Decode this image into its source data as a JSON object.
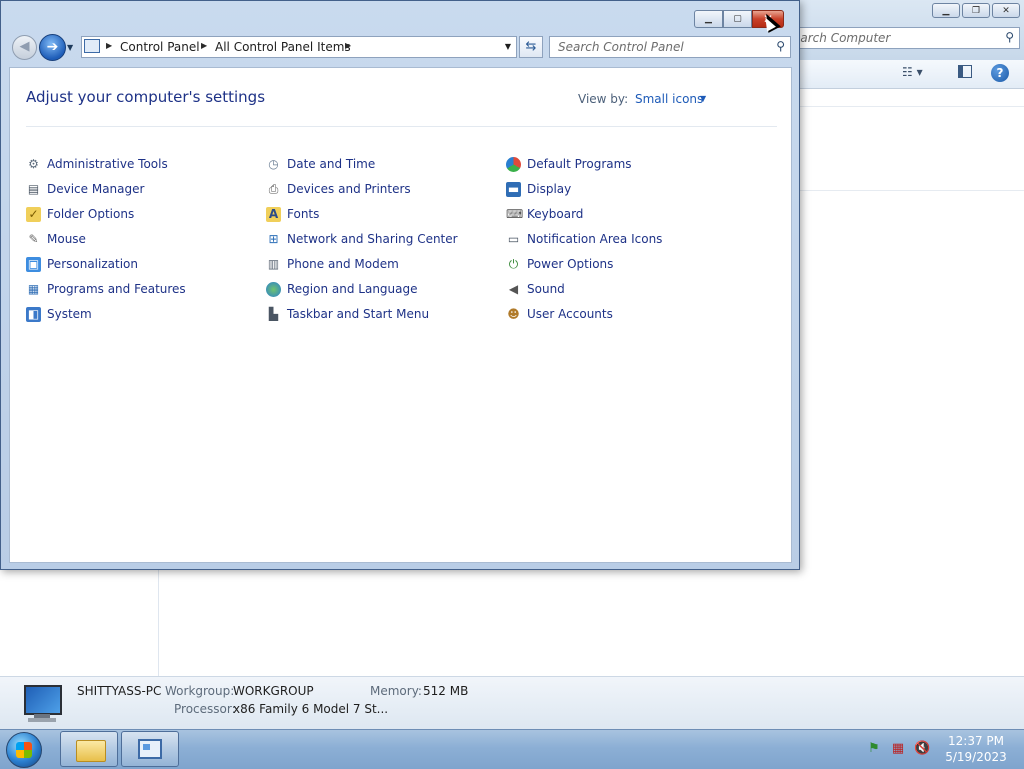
{
  "background_window": {
    "search_placeholder": "earch Computer"
  },
  "control_panel": {
    "breadcrumb": [
      "Control Panel",
      "All Control Panel Items"
    ],
    "search_placeholder": "Search Control Panel",
    "title": "Adjust your computer's settings",
    "view_by_label": "View by:",
    "view_by_value": "Small icons",
    "items": [
      {
        "label": "Administrative Tools",
        "icon": "admin-tools-icon"
      },
      {
        "label": "Device Manager",
        "icon": "device-manager-icon"
      },
      {
        "label": "Folder Options",
        "icon": "folder-options-icon"
      },
      {
        "label": "Mouse",
        "icon": "mouse-icon"
      },
      {
        "label": "Personalization",
        "icon": "personalization-icon"
      },
      {
        "label": "Programs and Features",
        "icon": "programs-icon"
      },
      {
        "label": "System",
        "icon": "system-icon"
      },
      {
        "label": "Date and Time",
        "icon": "clock-icon"
      },
      {
        "label": "Devices and Printers",
        "icon": "printer-icon"
      },
      {
        "label": "Fonts",
        "icon": "fonts-icon"
      },
      {
        "label": "Network and Sharing Center",
        "icon": "network-icon"
      },
      {
        "label": "Phone and Modem",
        "icon": "phone-icon"
      },
      {
        "label": "Region and Language",
        "icon": "globe-icon"
      },
      {
        "label": "Taskbar and Start Menu",
        "icon": "taskbar-icon"
      },
      {
        "label": "Default Programs",
        "icon": "default-programs-icon"
      },
      {
        "label": "Display",
        "icon": "display-icon"
      },
      {
        "label": "Keyboard",
        "icon": "keyboard-icon"
      },
      {
        "label": "Notification Area Icons",
        "icon": "notification-icon"
      },
      {
        "label": "Power Options",
        "icon": "power-icon"
      },
      {
        "label": "Sound",
        "icon": "speaker-icon"
      },
      {
        "label": "User Accounts",
        "icon": "users-icon"
      }
    ]
  },
  "details": {
    "computer_name": "SHITTYASS-PC",
    "workgroup_label": "Workgroup:",
    "workgroup_value": "WORKGROUP",
    "memory_label": "Memory:",
    "memory_value": "512 MB",
    "processor_label": "Processor:",
    "processor_value": "x86 Family 6 Model 7 St..."
  },
  "taskbar": {
    "time": "12:37 PM",
    "date": "5/19/2023"
  }
}
